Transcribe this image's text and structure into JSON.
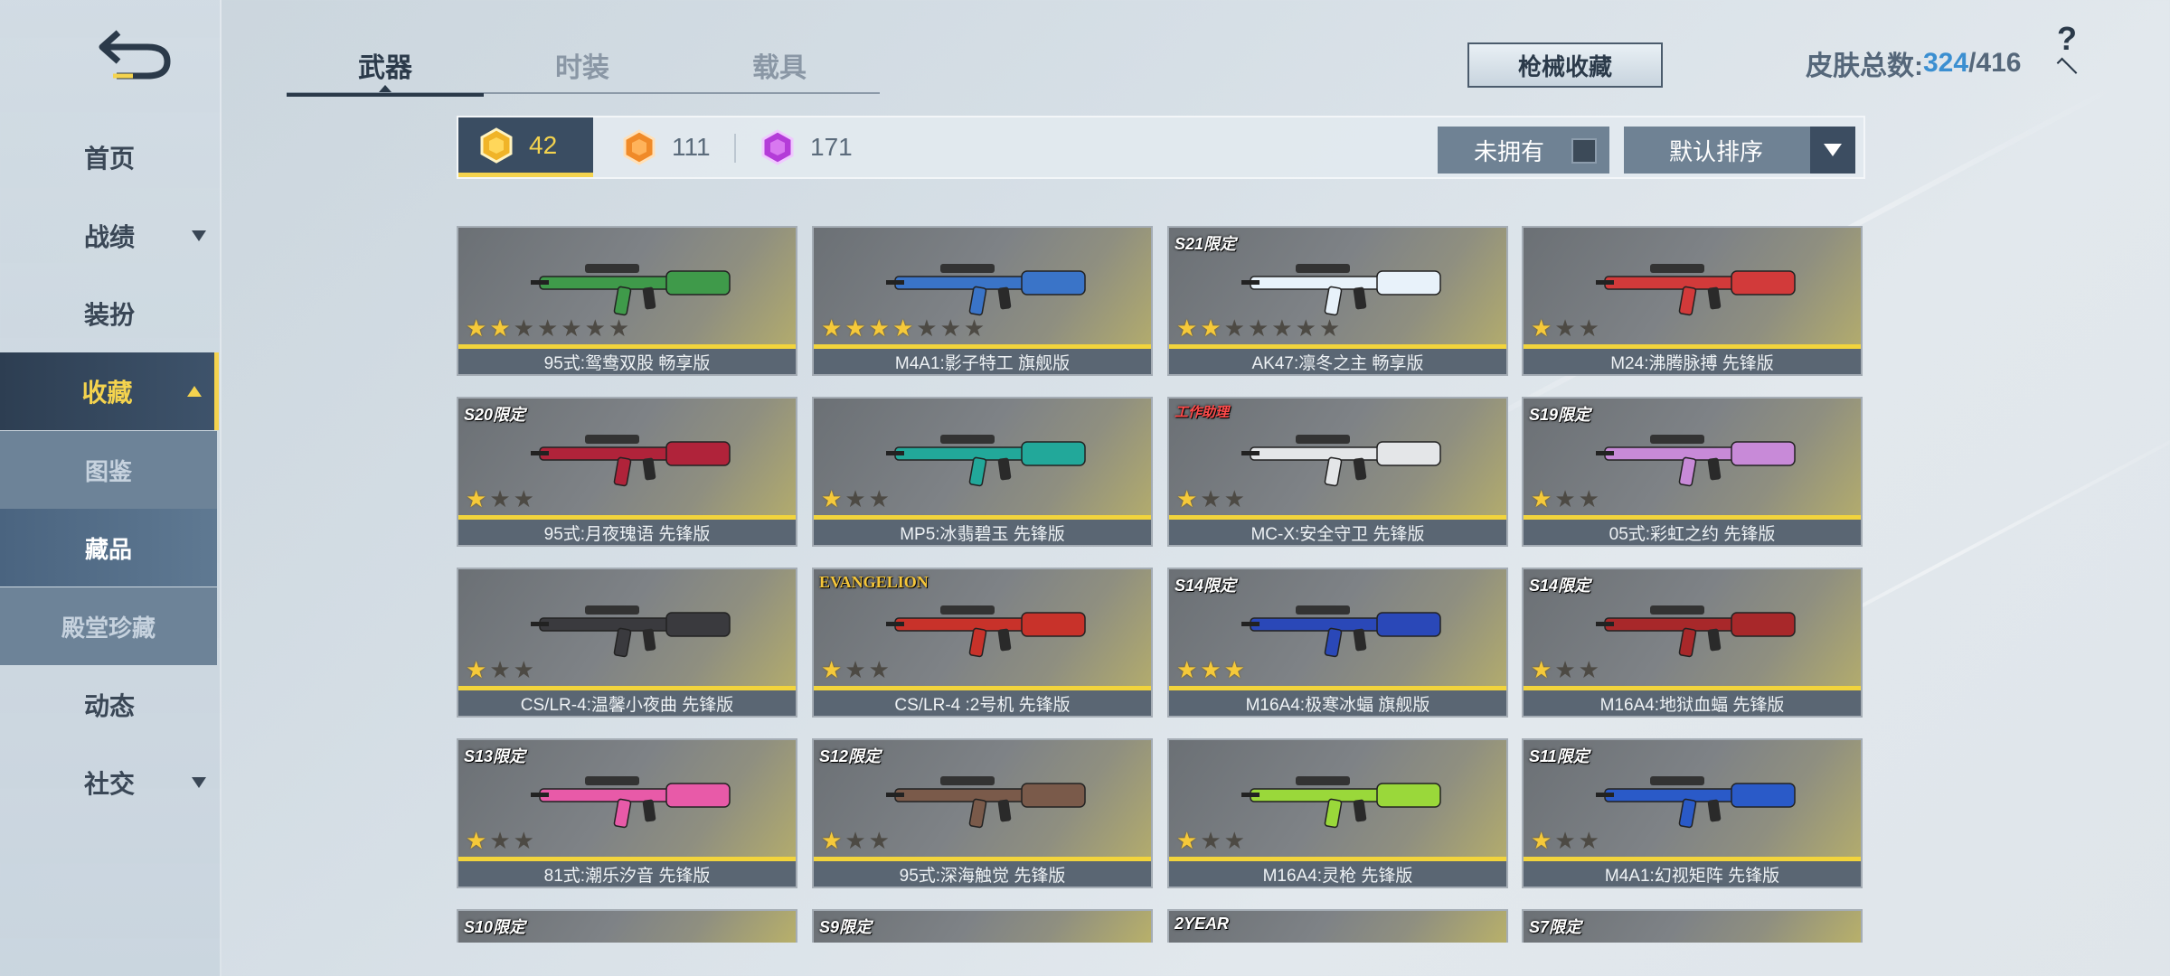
{
  "sidebar": {
    "items": [
      {
        "label": "首页",
        "has_arrow": false
      },
      {
        "label": "战绩",
        "has_arrow": true
      },
      {
        "label": "装扮",
        "has_arrow": false
      },
      {
        "label": "收藏",
        "has_arrow": true,
        "active": true
      },
      {
        "label": "动态",
        "has_arrow": false
      },
      {
        "label": "社交",
        "has_arrow": true
      }
    ],
    "sub_items": [
      {
        "label": "图鉴"
      },
      {
        "label": "藏品",
        "selected": true
      },
      {
        "label": "殿堂珍藏"
      }
    ]
  },
  "tabs": [
    {
      "label": "武器",
      "active": true
    },
    {
      "label": "时装"
    },
    {
      "label": "载具"
    }
  ],
  "header": {
    "collection_button": "枪械收藏",
    "skin_total_label": "皮肤总数:",
    "skin_owned": "324",
    "skin_separator": "/",
    "skin_total": "416",
    "help_label": "?"
  },
  "filter": {
    "currencies": [
      {
        "value": "42",
        "color": "#f0b428",
        "active": true
      },
      {
        "value": "111",
        "color": "#f08a28"
      },
      {
        "value": "171",
        "color": "#b43cd8"
      }
    ],
    "unowned_label": "未拥有",
    "sort_label": "默认排序"
  },
  "cards": [
    {
      "name": "95式:鸳鸯双股 畅享版",
      "stars": 2,
      "max_stars": 7,
      "badge": "",
      "gun_color": "#3f9a4a"
    },
    {
      "name": "M4A1:影子特工 旗舰版",
      "stars": 4,
      "max_stars": 7,
      "badge": "",
      "gun_color": "#3a74c8"
    },
    {
      "name": "AK47:凛冬之主 畅享版",
      "stars": 2,
      "max_stars": 7,
      "badge": "S21限定",
      "gun_color": "#e8f2fa"
    },
    {
      "name": "M24:沸腾脉搏 先锋版",
      "stars": 1,
      "max_stars": 3,
      "badge": "",
      "gun_color": "#d23a3a"
    },
    {
      "name": "95式:月夜瑰语 先锋版",
      "stars": 1,
      "max_stars": 3,
      "badge": "S20限定",
      "gun_color": "#b0233a"
    },
    {
      "name": "MP5:冰翡碧玉 先锋版",
      "stars": 1,
      "max_stars": 3,
      "badge": "",
      "gun_color": "#22a89a"
    },
    {
      "name": "MC-X:安全守卫 先锋版",
      "stars": 1,
      "max_stars": 3,
      "badge": "工作助理",
      "badge_style": "red",
      "gun_color": "#e4e6e8"
    },
    {
      "name": "05式:彩虹之约 先锋版",
      "stars": 1,
      "max_stars": 3,
      "badge": "S19限定",
      "gun_color": "#c88ad8"
    },
    {
      "name": "CS/LR-4:温馨小夜曲 先锋版",
      "stars": 1,
      "max_stars": 3,
      "badge": "",
      "gun_color": "#3a3a3e"
    },
    {
      "name": "CS/LR-4 :2号机 先锋版",
      "stars": 1,
      "max_stars": 3,
      "badge": "EVANGELION",
      "badge_style": "eva",
      "gun_color": "#c8322a"
    },
    {
      "name": "M16A4:极寒冰蝠 旗舰版",
      "stars": 3,
      "max_stars": 3,
      "badge": "S14限定",
      "gun_color": "#2a48b8"
    },
    {
      "name": "M16A4:地狱血蝠 先锋版",
      "stars": 1,
      "max_stars": 3,
      "badge": "S14限定",
      "gun_color": "#a8282a"
    },
    {
      "name": "81式:潮乐汐音 先锋版",
      "stars": 1,
      "max_stars": 3,
      "badge": "S13限定",
      "gun_color": "#e85aa8"
    },
    {
      "name": "95式:深海触觉 先锋版",
      "stars": 1,
      "max_stars": 3,
      "badge": "S12限定",
      "gun_color": "#7a5a4a"
    },
    {
      "name": "M16A4:灵枪 先锋版",
      "stars": 1,
      "max_stars": 3,
      "badge": "",
      "badge_style": "orange",
      "gun_color": "#9ad83a"
    },
    {
      "name": "M4A1:幻视矩阵 先锋版",
      "stars": 1,
      "max_stars": 3,
      "badge": "S11限定",
      "gun_color": "#2a5ac8"
    },
    {
      "name": "",
      "stars": 0,
      "max_stars": 3,
      "badge": "S10限定",
      "partial": true
    },
    {
      "name": "",
      "stars": 0,
      "max_stars": 3,
      "badge": "S9限定",
      "partial": true
    },
    {
      "name": "",
      "stars": 0,
      "max_stars": 3,
      "badge": "2YEAR",
      "partial": true
    },
    {
      "name": "",
      "stars": 0,
      "max_stars": 3,
      "badge": "S7限定",
      "partial": true
    }
  ]
}
